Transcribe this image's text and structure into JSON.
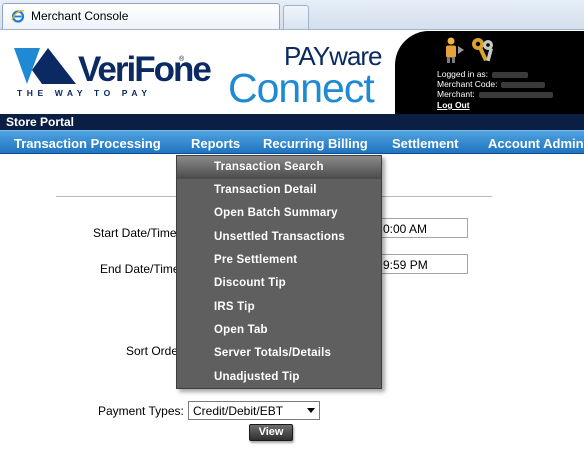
{
  "browser": {
    "tab_title": "Merchant Console"
  },
  "header": {
    "verifone_word": "VeriFone",
    "verifone_tagline": "THE WAY TO PAY",
    "trademark": "®",
    "payware_top": "PAYware",
    "payware_bottom": "Connect",
    "logged_in_label": "Logged in as:",
    "merchant_code_label": "Merchant Code:",
    "merchant_label": "Merchant:",
    "logout_label": "Log Out"
  },
  "portal": {
    "title": "Store Portal"
  },
  "nav": {
    "items": [
      "Transaction Processing",
      "Reports",
      "Recurring Billing",
      "Settlement",
      "Account Admin"
    ]
  },
  "reports_menu": {
    "items": [
      "Transaction Search",
      "Transaction Detail",
      "Open Batch Summary",
      "Unsettled Transactions",
      "Pre Settlement",
      "Discount Tip",
      "IRS Tip",
      "Open Tab",
      "Server Totals/Details",
      "Unadjusted Tip"
    ],
    "active_item": "Transaction Search"
  },
  "form": {
    "start_date_label": "Start Date/Time",
    "start_time_value": "0:00 AM",
    "end_date_label": "End Date/Time",
    "end_time_value": "9:59 PM",
    "sort_order_label": "Sort Orde",
    "payment_types_label": "Payment Types:",
    "payment_types_value": "Credit/Debit/EBT",
    "view_button": "View"
  },
  "colors": {
    "nav_blue": "#2f86cf",
    "portal_bar": "#0b1f44",
    "menu_bg": "#5f5f5f",
    "verifone_navy": "#0b2a63",
    "payware_blue": "#1e8ad3"
  }
}
